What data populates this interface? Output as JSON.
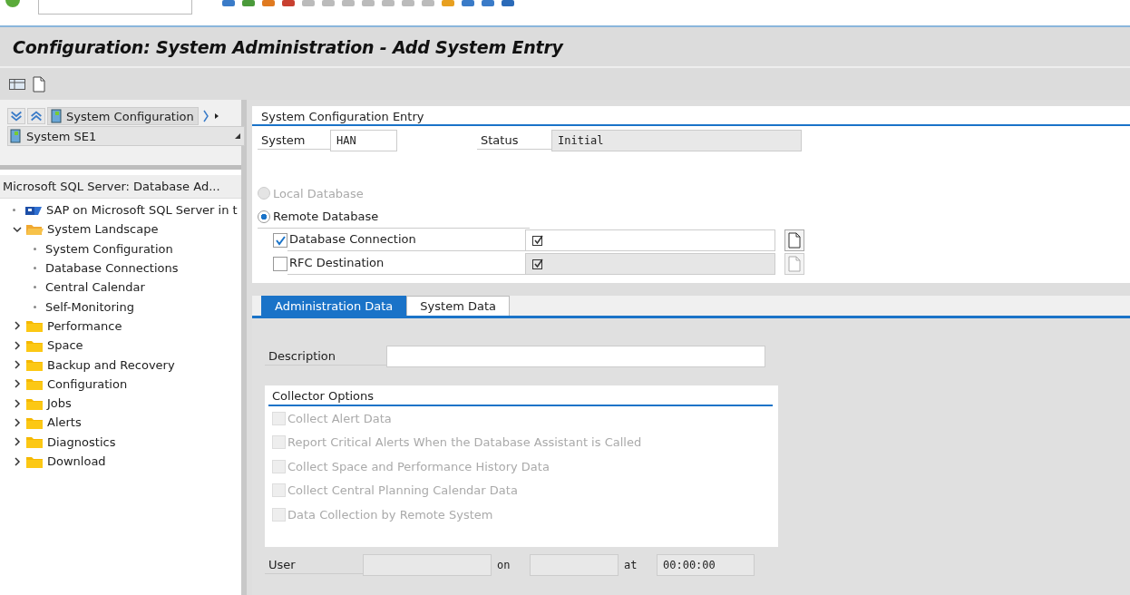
{
  "window": {
    "title": "Configuration: System Administration - Add System Entry"
  },
  "nav": {
    "selector": "System Configuration",
    "system": "System SE1",
    "tree_title": "Microsoft SQL Server: Database Ad...",
    "tree": [
      {
        "label": "SAP on Microsoft SQL Server in t",
        "kind": "logo"
      },
      {
        "label": "System Landscape",
        "kind": "folder",
        "expanded": true,
        "children": [
          {
            "label": "System Configuration",
            "kind": "leaf"
          },
          {
            "label": "Database Connections",
            "kind": "leaf"
          },
          {
            "label": "Central Calendar",
            "kind": "leaf"
          },
          {
            "label": "Self-Monitoring",
            "kind": "leaf"
          }
        ]
      },
      {
        "label": "Performance",
        "kind": "folder",
        "expanded": false
      },
      {
        "label": "Space",
        "kind": "folder",
        "expanded": false
      },
      {
        "label": "Backup and Recovery",
        "kind": "folder",
        "expanded": false
      },
      {
        "label": "Configuration",
        "kind": "folder",
        "expanded": false
      },
      {
        "label": "Jobs",
        "kind": "folder",
        "expanded": false
      },
      {
        "label": "Alerts",
        "kind": "folder",
        "expanded": false
      },
      {
        "label": "Diagnostics",
        "kind": "folder",
        "expanded": false
      },
      {
        "label": "Download",
        "kind": "folder",
        "expanded": false
      }
    ]
  },
  "entry": {
    "title": "System Configuration Entry",
    "system": {
      "label": "System",
      "value": "HAN"
    },
    "status": {
      "label": "Status",
      "value": "Initial"
    },
    "database_options": [
      {
        "label": "Local Database",
        "selected": false,
        "disabled": true
      },
      {
        "label": "Remote Database",
        "selected": true,
        "disabled": false
      }
    ],
    "connections": [
      {
        "label": "Database Connection",
        "checked": true,
        "disabled": false
      },
      {
        "label": "RFC Destination",
        "checked": false,
        "disabled": true
      }
    ]
  },
  "tabs": [
    {
      "label": "Administration Data",
      "selected": true
    },
    {
      "label": "System Data",
      "selected": false
    }
  ],
  "description": {
    "label": "Description"
  },
  "collector": {
    "title": "Collector Options",
    "options": [
      {
        "label": "Collect Alert Data",
        "checked": false,
        "disabled": true
      },
      {
        "label": "Report Critical Alerts When the Database Assistant is Called",
        "checked": false,
        "disabled": true
      },
      {
        "label": "Collect Space and Performance History Data",
        "checked": false,
        "disabled": true
      },
      {
        "label": "Collect Central Planning Calendar Data",
        "checked": false,
        "disabled": true
      },
      {
        "label": "Data Collection by Remote System",
        "checked": false,
        "disabled": true
      }
    ]
  },
  "changed": {
    "user_label": "User",
    "on_label": "on",
    "at_label": "at",
    "time": "00:00:00"
  }
}
